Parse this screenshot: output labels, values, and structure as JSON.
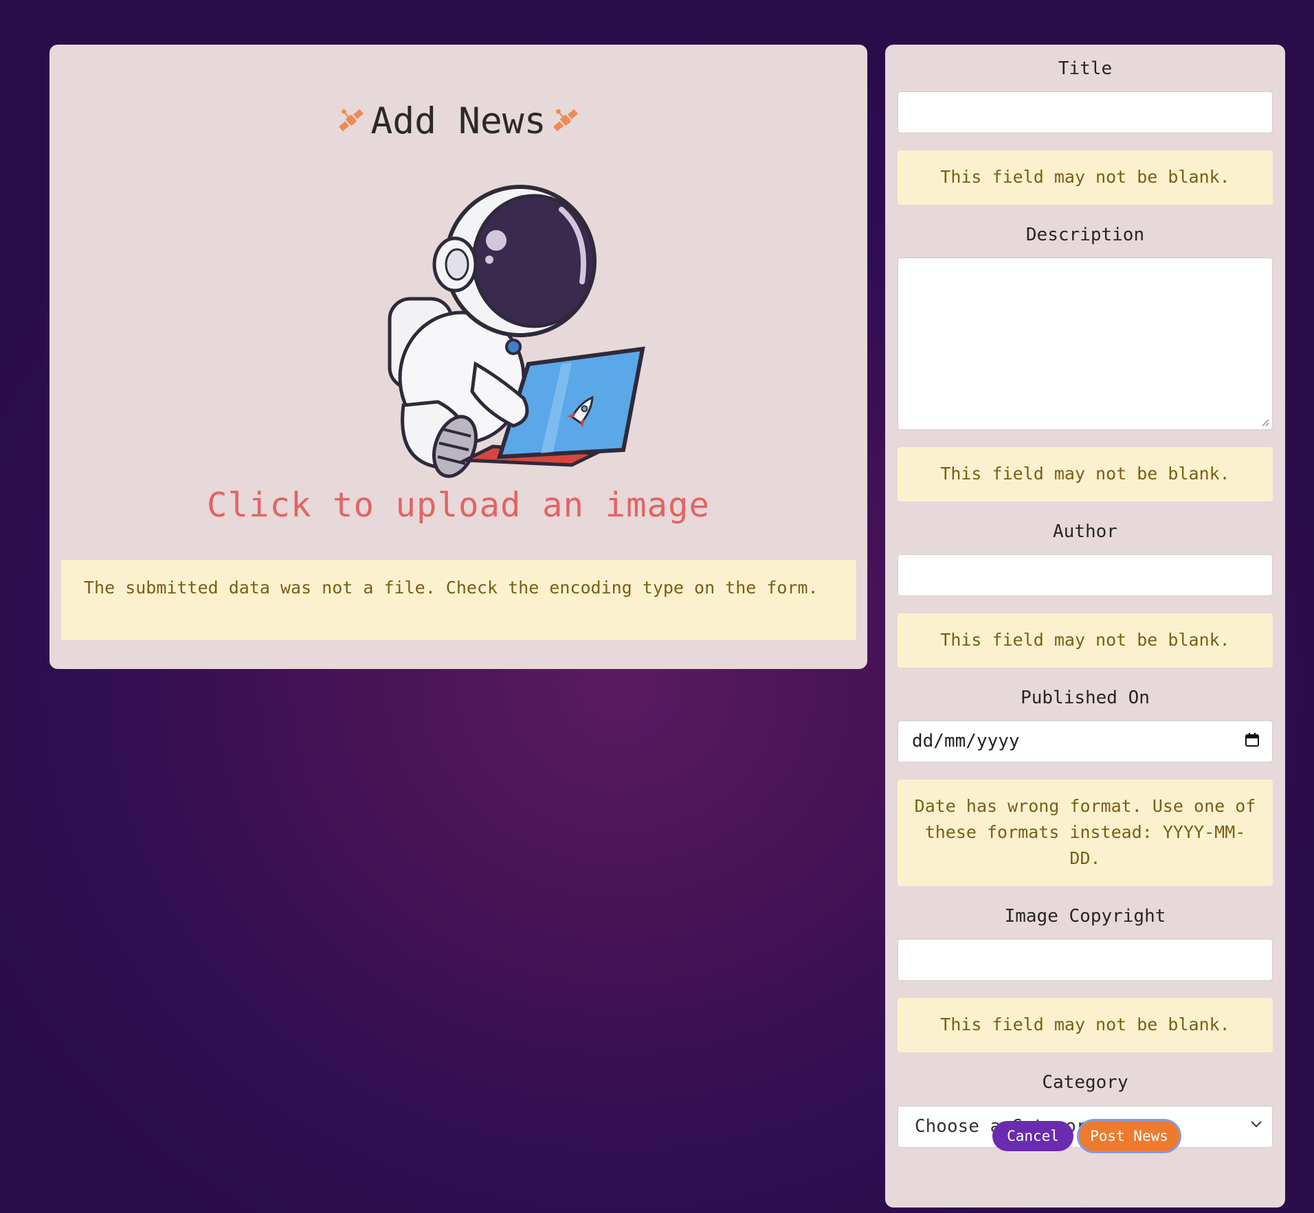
{
  "page": {
    "title": "Add News",
    "upload_prompt": "Click to upload an image",
    "image_error": "The submitted data was not a file. Check the encoding type on the form."
  },
  "form": {
    "title": {
      "label": "Title",
      "value": "",
      "error": "This field may not be blank."
    },
    "description": {
      "label": "Description",
      "value": "",
      "error": "This field may not be blank."
    },
    "author": {
      "label": "Author",
      "value": "",
      "error": "This field may not be blank."
    },
    "published_on": {
      "label": "Published On",
      "placeholder": "dd/mm/yyyy",
      "error": "Date has wrong format. Use one of these formats instead: YYYY-MM-DD."
    },
    "image_copyright": {
      "label": "Image Copyright",
      "value": "",
      "error": "This field may not be blank."
    },
    "category": {
      "label": "Category",
      "selected": "Choose a Category"
    }
  },
  "buttons": {
    "cancel": "Cancel",
    "post": "Post News"
  },
  "icons": {
    "title_decoration": "satellite-icon",
    "date_picker": "calendar-icon",
    "select": "chevron-down-icon",
    "illustration": "astronaut-with-laptop"
  },
  "colors": {
    "background": "#3a0f56",
    "panel": "#e7d8d9",
    "notice_bg": "#fcf1cf",
    "notice_text": "#7a5e14",
    "upload_text": "#e26464",
    "cancel": "#6a2bb0",
    "post": "#ee7a2e",
    "satellite": "#ee8a55"
  }
}
